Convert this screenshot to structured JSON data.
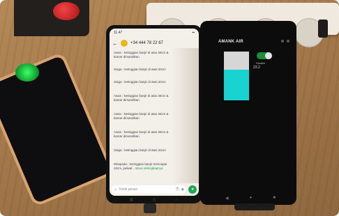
{
  "colors": {
    "water": "#18d3d0",
    "tank_empty": "#d6d6d6",
    "toggle_on": "#1f8c3e",
    "whatsapp_green": "#1fa855",
    "phone_bezel": "#121212",
    "table_wood": "#a57a4c"
  },
  "chat_phone": {
    "contact": "+34 444 78 22 67",
    "messages": [
      {
        "line1": "Awas : ketinggian banjir di atas 30cm &",
        "line2": "kamar dimandikan"
      },
      {
        "line1": "Siaga : ketinggian banjir di atas 20cm",
        "line2": ""
      },
      {
        "line1": "Siaga : ketinggian banjir di atas 20cm",
        "line2": ""
      },
      {
        "line1": "Awas : ketinggian banjir di atas 30cm &",
        "line2": "kamar dimandikan"
      },
      {
        "line1": "Awas : ketinggian banjir di atas 30cm &",
        "line2": "kamar dimandikan"
      },
      {
        "line1": "Awas : ketinggian banjir di atas 30cm &",
        "line2": "kamar dimandikan"
      },
      {
        "line1": "Siaga : ketinggian banjir di atas 20cm",
        "line2": ""
      }
    ],
    "last_message": {
      "line1": "Waspada : ketinggian banjir mencapai",
      "line2": "10cm, jadwal...",
      "link": "Baca selengkapnya"
    },
    "time": "11.47",
    "input_placeholder": "Ketik pesan"
  },
  "monitor_phone": {
    "app_title": "AMANK AIR",
    "toggle_label": "Disable",
    "reading": "23.2",
    "water_level_fraction": 0.63,
    "toggle_on": true
  },
  "icons": [
    "back-icon",
    "emoji-icon",
    "attach-icon",
    "camera-icon",
    "mic-icon",
    "nav-back-icon",
    "nav-home-icon",
    "nav-recent-icon"
  ]
}
